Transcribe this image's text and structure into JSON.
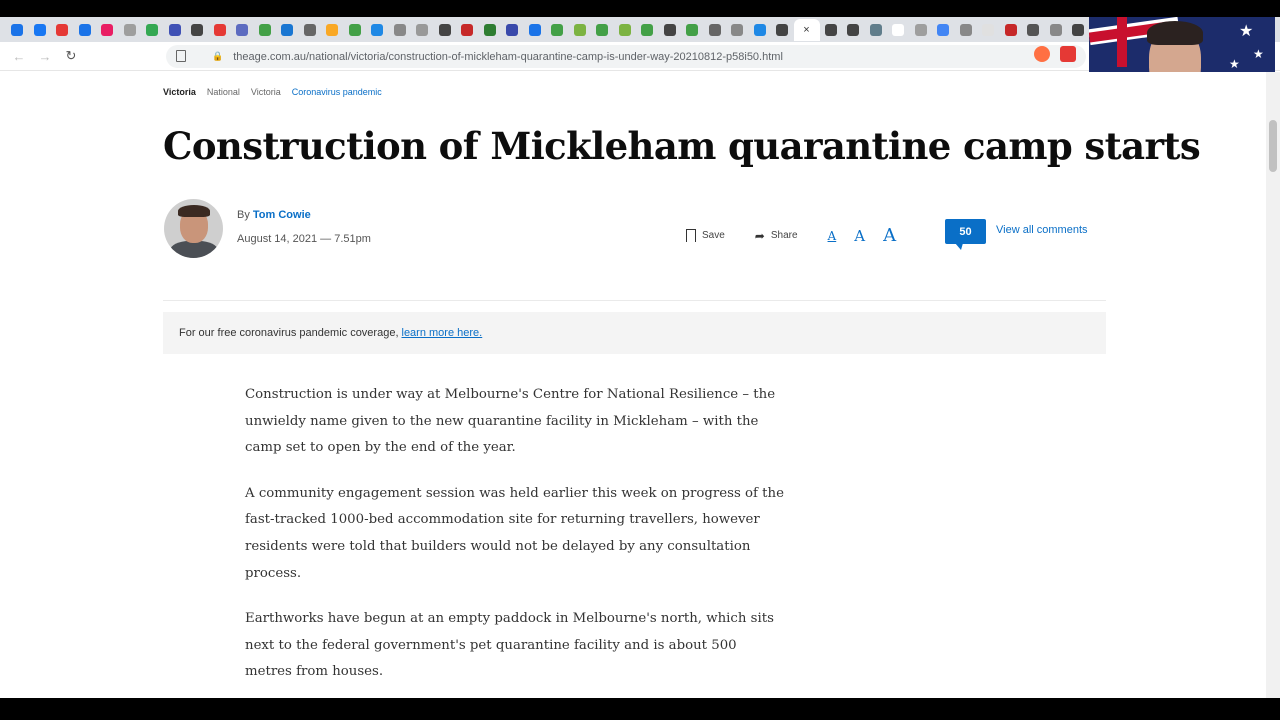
{
  "browser": {
    "url": "theage.com.au/national/victoria/construction-of-mickleham-quarantine-camp-is-under-way-20210812-p58i50.html",
    "active_tab_close": "×",
    "tab_colors": [
      "#1a73e8",
      "#1877f2",
      "#e53935",
      "#1a73e8",
      "#e91e63",
      "#9e9e9e",
      "#34a853",
      "#3f51b5",
      "#444",
      "#e53935",
      "#5c6bc0",
      "#43a047",
      "#1976d2",
      "#666",
      "#f9a825",
      "#43a047",
      "#1e88e5",
      "#888",
      "#999",
      "#444",
      "#c62828",
      "#2e7d32",
      "#3949ab",
      "#1a73e8",
      "#43a047",
      "#7cb342",
      "#43a047",
      "#7cb342",
      "#43a047",
      "#444",
      "#43a047",
      "#666",
      "#888",
      "#1e88e5",
      "#444",
      "#444",
      "#444",
      "#607d8b",
      "#fff",
      "#9e9e9e",
      "#4285f4",
      "#888",
      "#e0e0e0",
      "#c62828",
      "#555",
      "#888",
      "#444",
      "#1da1f2",
      "#444",
      "#444",
      "#1565c0",
      "#444",
      "#43a047",
      "#444",
      "#666"
    ]
  },
  "article": {
    "breadcrumb": [
      "Victoria",
      "National",
      "Victoria",
      "Coronavirus pandemic"
    ],
    "headline": "Construction of Mickleham quarantine camp starts",
    "by_label": "By",
    "author": "Tom Cowie",
    "date": "August 14, 2021 — 7.51pm",
    "save_label": "Save",
    "share_label": "Share",
    "font_small": "A",
    "font_medium": "A",
    "font_large": "A",
    "comment_count": "50",
    "view_comments": "View all comments",
    "notice_text": "For our free coronavirus pandemic coverage,",
    "notice_link": "learn more here.",
    "paragraphs": [
      "Construction is under way at Melbourne's Centre for National Resilience – the unwieldy name given to the new quarantine facility in Mickleham – with the camp set to open by the end of the year.",
      "A community engagement session was held earlier this week on progress of the fast-tracked 1000-bed accommodation site for returning travellers, however residents were told that builders would not be delayed by any consultation process.",
      "Earthworks have begun at an empty paddock in Melbourne's north, which sits next to the federal government's pet quarantine facility and is about 500 metres from houses."
    ]
  }
}
